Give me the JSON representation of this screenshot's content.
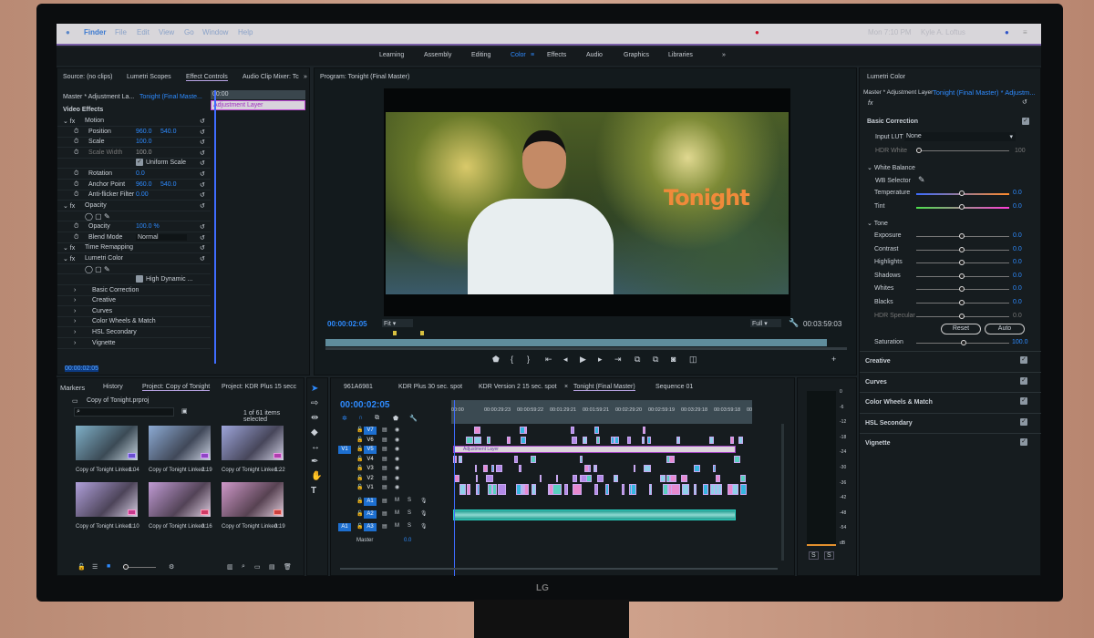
{
  "menubar": {
    "apple": "",
    "items": [
      "Finder",
      "File",
      "Edit",
      "View",
      "Go",
      "Window",
      "Help"
    ],
    "clock": "Mon 7:10 PM",
    "user": "Kyle A. Loftus"
  },
  "workspaces": {
    "items": [
      "Learning",
      "Assembly",
      "Editing",
      "Color",
      "Effects",
      "Audio",
      "Graphics",
      "Libraries"
    ],
    "active": "Color",
    "more": "»"
  },
  "effect_panel": {
    "tabs": [
      "Source: (no clips)",
      "Lumetri Scopes",
      "Effect Controls",
      "Audio Clip Mixer: Tc"
    ],
    "more": "»",
    "master": "Master * Adjustment La...",
    "sequence": "Tonight (Final Maste...",
    "ruler_start": "00:00",
    "clip": "Adjustment Layer",
    "section": "Video Effects",
    "rows": [
      {
        "label": "Motion",
        "type": "fx"
      },
      {
        "label": "Position",
        "v1": "960.0",
        "v2": "540.0"
      },
      {
        "label": "Scale",
        "v1": "100.0"
      },
      {
        "label": "Scale Width",
        "v1": "100.0",
        "dim": true
      },
      {
        "label": "Uniform Scale",
        "type": "check"
      },
      {
        "label": "Rotation",
        "v1": "0.0"
      },
      {
        "label": "Anchor Point",
        "v1": "960.0",
        "v2": "540.0"
      },
      {
        "label": "Anti-flicker Filter",
        "v1": "0.00"
      },
      {
        "label": "Opacity",
        "type": "fx"
      },
      {
        "label": "",
        "type": "masks"
      },
      {
        "label": "Opacity",
        "v1": "100.0 %"
      },
      {
        "label": "Blend Mode",
        "v1": "Normal",
        "type": "select"
      },
      {
        "label": "Time Remapping",
        "type": "fx"
      },
      {
        "label": "Lumetri Color",
        "type": "fx"
      },
      {
        "label": "",
        "type": "masks"
      },
      {
        "label": "High Dynamic ...",
        "type": "check"
      },
      {
        "label": "Basic Correction",
        "type": "sub"
      },
      {
        "label": "Creative",
        "type": "sub"
      },
      {
        "label": "Curves",
        "type": "sub"
      },
      {
        "label": "Color Wheels & Match",
        "type": "sub"
      },
      {
        "label": "HSL Secondary",
        "type": "sub"
      },
      {
        "label": "Vignette",
        "type": "sub"
      }
    ],
    "timecode": "00:00:02:05"
  },
  "program": {
    "title": "Program: Tonight (Final Master)",
    "overlay_text": "Tonight",
    "timecode": "00:00:02:05",
    "fit": "Fit",
    "quality": "Full",
    "duration": "00:03:59:03"
  },
  "project": {
    "tabs": [
      "Markers",
      "History",
      "Project: Copy of Tonight",
      "Project: KDR Plus 15 secc"
    ],
    "file": "Copy of Tonight.prproj",
    "search_placeholder": "",
    "selected": "1 of 61 items selected",
    "items": [
      {
        "name": "Copy of Tonight Linked...",
        "dur": "1:04"
      },
      {
        "name": "Copy of Tonight Linked...",
        "dur": "2:19"
      },
      {
        "name": "Copy of Tonight Linked...",
        "dur": "1:22"
      },
      {
        "name": "Copy of Tonight Linked...",
        "dur": "1:10"
      },
      {
        "name": "Copy of Tonight Linked...",
        "dur": "0:16"
      },
      {
        "name": "Copy of Tonight Linked...",
        "dur": "0:19"
      }
    ]
  },
  "timeline": {
    "tabs": [
      "961A6981",
      "KDR Plus 30 sec. spot",
      "KDR Version 2 15 sec. spot",
      "Tonight (Final Master)",
      "Sequence 01"
    ],
    "close": "×",
    "timecode": "00:00:02:05",
    "ruler": [
      "00:00",
      "00:00:29:23",
      "00:00:59:22",
      "00:01:29:21",
      "00:01:59:21",
      "00:02:29:20",
      "00:02:59:19",
      "00:03:29:18",
      "00:03:59:18",
      "00"
    ],
    "video_tracks": [
      "V7",
      "V6",
      "V5",
      "V4",
      "V3",
      "V2",
      "V1"
    ],
    "audio_tracks": [
      "A1",
      "A2",
      "A3"
    ],
    "source_v": "V1",
    "source_a": "A1",
    "m": "M",
    "s": "S",
    "master": "Master",
    "master_val": "0.0",
    "adj_clip": "Adjustment Layer"
  },
  "meter": {
    "ticks": [
      "0",
      "-6",
      "-12",
      "-18",
      "-24",
      "-30",
      "-36",
      "-42",
      "-48",
      "-54",
      "dB"
    ],
    "solo": [
      "S",
      "S"
    ]
  },
  "lumetri": {
    "title": "Lumetri Color",
    "master": "Master * Adjustment Layer",
    "sequence": "Tonight (Final Master) * Adjustm...",
    "fx": "fx",
    "basic": "Basic Correction",
    "input_lut_label": "Input LUT",
    "input_lut": "None",
    "hdr_white": "HDR White",
    "hdr_white_val": "100",
    "wb": "White Balance",
    "wb_selector": "WB Selector",
    "tone": "Tone",
    "sliders": [
      {
        "label": "Temperature",
        "value": "0.0",
        "pos": 0.5
      },
      {
        "label": "Tint",
        "value": "0.0",
        "pos": 0.5
      }
    ],
    "tone_sliders": [
      {
        "label": "Exposure",
        "value": "0.0",
        "pos": 0.5
      },
      {
        "label": "Contrast",
        "value": "0.0",
        "pos": 0.5
      },
      {
        "label": "Highlights",
        "value": "0.0",
        "pos": 0.5
      },
      {
        "label": "Shadows",
        "value": "0.0",
        "pos": 0.5
      },
      {
        "label": "Whites",
        "value": "0.0",
        "pos": 0.5
      },
      {
        "label": "Blacks",
        "value": "0.0",
        "pos": 0.5
      },
      {
        "label": "HDR Specular",
        "value": "0.0",
        "pos": 0.5,
        "dim": true
      }
    ],
    "reset": "Reset",
    "auto": "Auto",
    "saturation": "Saturation",
    "saturation_val": "100.0",
    "saturation_pos": 0.5,
    "sections": [
      "Creative",
      "Curves",
      "Color Wheels & Match",
      "HSL Secondary",
      "Vignette"
    ]
  },
  "monitor_brand": "LG"
}
